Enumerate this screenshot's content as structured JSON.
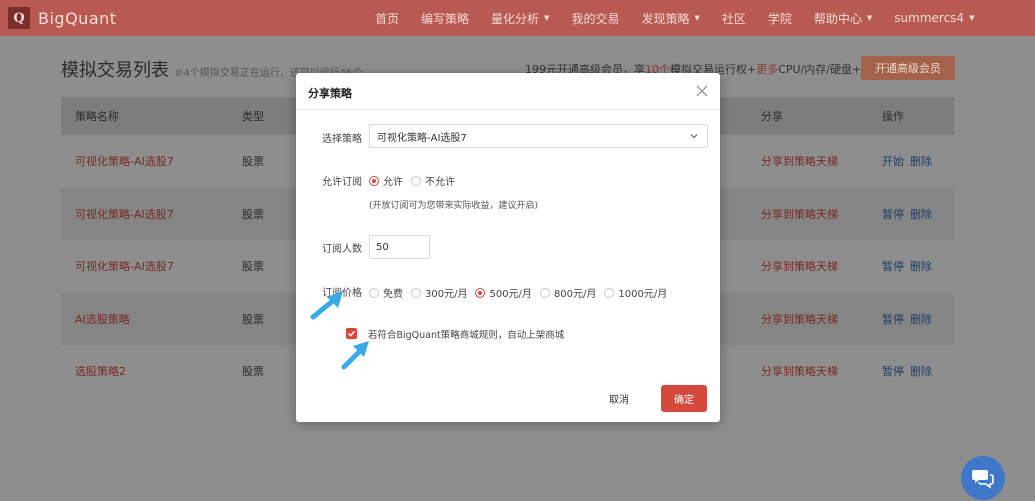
{
  "brand": {
    "logo_letter": "Q",
    "name": "BigQuant"
  },
  "nav": [
    {
      "label": "首页",
      "has_caret": false
    },
    {
      "label": "编写策略",
      "has_caret": false
    },
    {
      "label": "量化分析",
      "has_caret": true
    },
    {
      "label": "我的交易",
      "has_caret": false
    },
    {
      "label": "发现策略",
      "has_caret": true
    },
    {
      "label": "社区",
      "has_caret": false
    },
    {
      "label": "学院",
      "has_caret": false
    },
    {
      "label": "帮助中心",
      "has_caret": true
    },
    {
      "label": "summercs4",
      "has_caret": true
    }
  ],
  "page": {
    "title": "模拟交易列表",
    "subtitle": "⊘4个模拟交易正在运行，还可以运行46个",
    "promo_prefix": "199元开通高级会员，享",
    "promo_count": "10个",
    "promo_middle": "模拟交易运行权+",
    "promo_more": "更多",
    "promo_suffix": "CPU/内存/硬盘+...",
    "vip_button": "开通高级会员"
  },
  "table": {
    "headers": {
      "name": "策略名称",
      "type": "类型",
      "share": "分享",
      "op": "操作"
    },
    "rows": [
      {
        "name": "可视化策略-AI选股7",
        "type": "股票",
        "share": "分享到策略天梯",
        "op1": "开始",
        "op2": "删除"
      },
      {
        "name": "可视化策略-AI选股7",
        "type": "股票",
        "share": "分享到策略天梯",
        "op1": "暂停",
        "op2": "删除"
      },
      {
        "name": "可视化策略-AI选股7",
        "type": "股票",
        "share": "分享到策略天梯",
        "op1": "暂停",
        "op2": "删除"
      },
      {
        "name": "AI选股策略",
        "type": "股票",
        "share": "分享到策略天梯",
        "op1": "暂停",
        "op2": "删除"
      },
      {
        "name": "选股策略2",
        "type": "股票",
        "share": "分享到策略天梯",
        "op1": "暂停",
        "op2": "删除"
      }
    ]
  },
  "modal": {
    "title": "分享策略",
    "select_label": "选择策略",
    "select_value": "可视化策略-AI选股7",
    "allow_label": "允许订阅",
    "allow_options": [
      {
        "label": "允许",
        "selected": true
      },
      {
        "label": "不允许",
        "selected": false
      }
    ],
    "allow_hint": "(开放订阅可为您带来实际收益，建议开启)",
    "count_label": "订阅人数",
    "count_value": "50",
    "price_label": "订阅价格",
    "price_options": [
      {
        "label": "免费",
        "selected": false
      },
      {
        "label": "300元/月",
        "selected": false
      },
      {
        "label": "500元/月",
        "selected": true
      },
      {
        "label": "800元/月",
        "selected": false
      },
      {
        "label": "1000元/月",
        "selected": false
      }
    ],
    "mall_checkbox_label": "若符合BigQuant策略商城规则，自动上架商城",
    "mall_checked": true,
    "cancel": "取消",
    "confirm": "确定"
  },
  "colors": {
    "accent": "#d9463a",
    "nav_bg": "#b85a52",
    "arrow": "#3aa9e8",
    "chat": "#3f77c9"
  },
  "icons": {
    "close": "close-icon",
    "chevron": "chevron-down-icon",
    "chat": "chat-icon",
    "check": "check-icon"
  }
}
